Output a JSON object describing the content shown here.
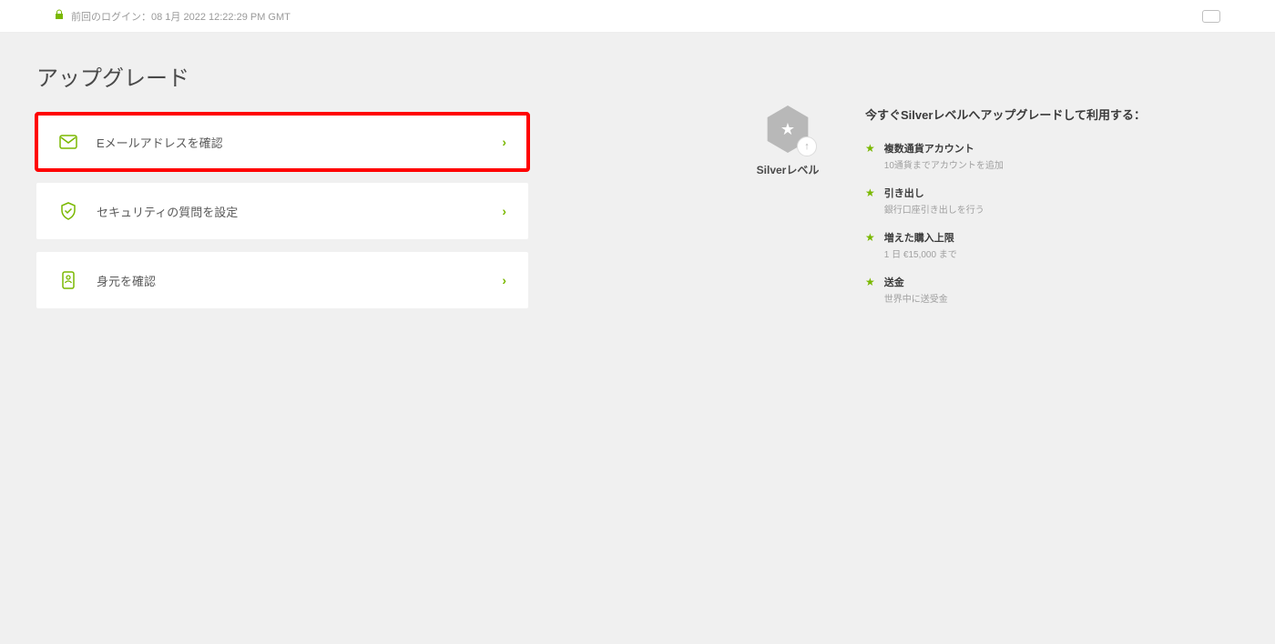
{
  "header": {
    "last_login_text": "前回のログイン：08 1月 2022 12:22:29 PM GMT"
  },
  "page_title": "アップグレード",
  "tasks": [
    {
      "label": "Eメールアドレスを確認",
      "icon": "mail-icon",
      "highlighted": true
    },
    {
      "label": "セキュリティの質問を設定",
      "icon": "shield-icon",
      "highlighted": false
    },
    {
      "label": "身元を確認",
      "icon": "id-icon",
      "highlighted": false
    }
  ],
  "level": {
    "label": "Silverレベル"
  },
  "benefits": {
    "title": "今すぐSilverレベルへアップグレードして利用する：",
    "items": [
      {
        "title": "複数通貨アカウント",
        "desc": "10通貨までアカウントを追加"
      },
      {
        "title": "引き出し",
        "desc": "銀行口座引き出しを行う"
      },
      {
        "title": "増えた購入上限",
        "desc": "1 日 €15,000 まで"
      },
      {
        "title": "送金",
        "desc": "世界中に送受金"
      }
    ]
  }
}
